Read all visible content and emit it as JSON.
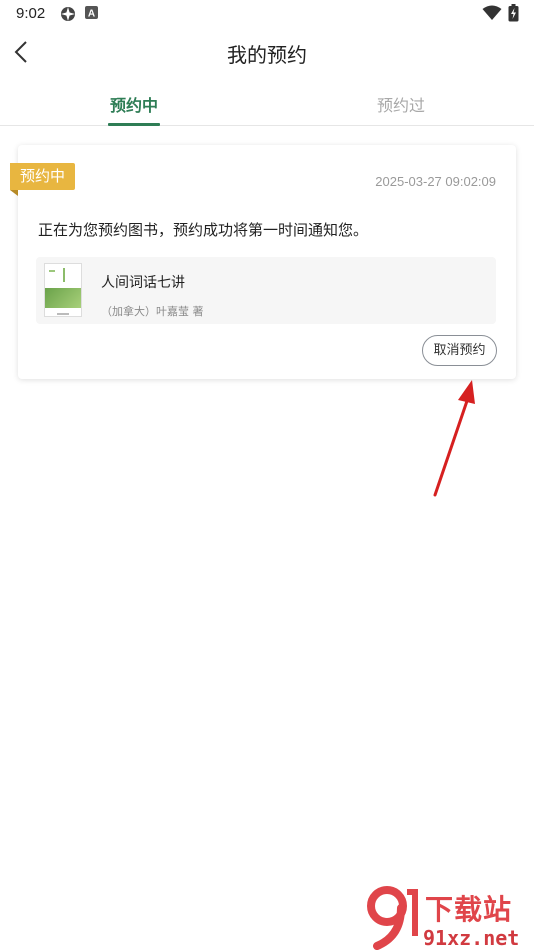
{
  "status_bar": {
    "time": "9:02",
    "left_icons": [
      "network-icon",
      "a-badge-icon"
    ],
    "right_icons": [
      "wifi-icon",
      "battery-icon"
    ]
  },
  "nav": {
    "back_icon": "chevron-left-icon",
    "title": "我的预约"
  },
  "tabs": [
    {
      "label": "预约中",
      "active": true
    },
    {
      "label": "预约过",
      "active": false
    }
  ],
  "reservation": {
    "status_badge": "预约中",
    "timestamp": "2025-03-27 09:02:09",
    "message": "正在为您预约图书，预约成功将第一时间通知您。",
    "book": {
      "title": "人间词话七讲",
      "author": "（加拿大）叶嘉莹 著"
    },
    "cancel_label": "取消预约"
  },
  "watermark": {
    "main": "下载站",
    "sub": "91xz.net"
  },
  "colors": {
    "accent_green": "#2e7d55",
    "badge_gold": "#e8b640",
    "annotation_red": "#d62020"
  }
}
